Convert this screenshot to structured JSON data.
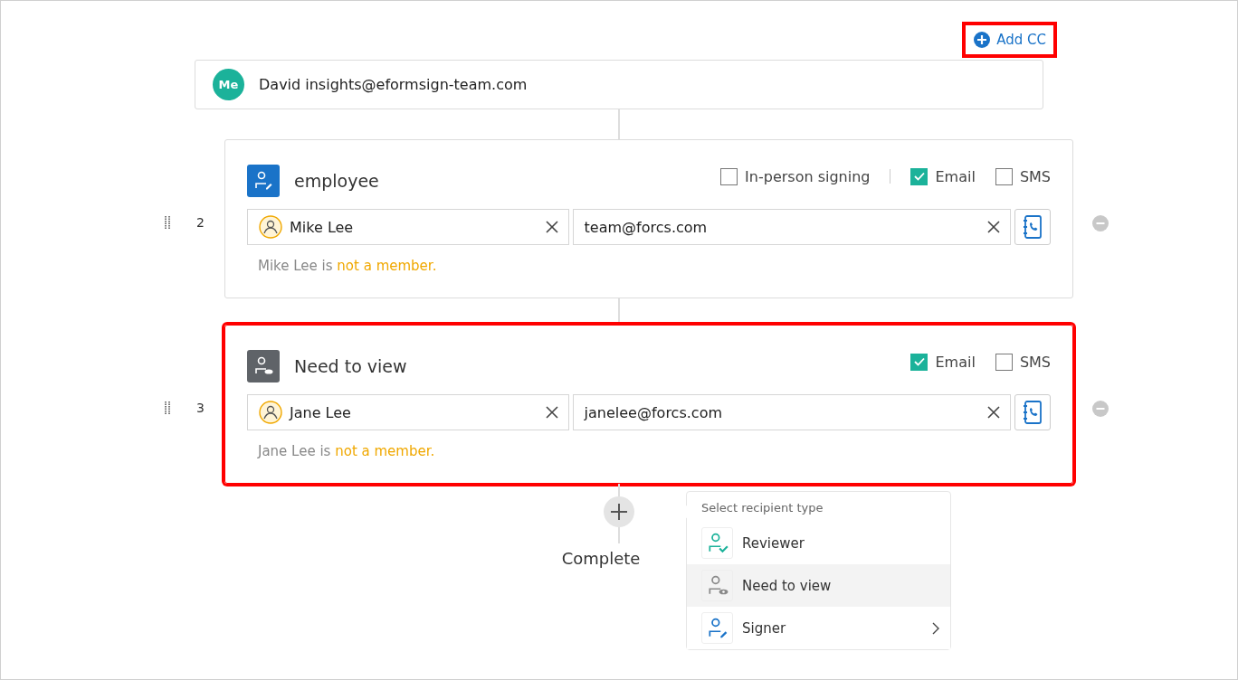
{
  "add_cc": {
    "label": "Add CC",
    "highlighted": true
  },
  "me": {
    "avatar": "Me",
    "text": "David insights@eformsign-team.com"
  },
  "steps": [
    {
      "number": "2",
      "role": {
        "kind": "signer",
        "title": "employee"
      },
      "highlighted": false,
      "options": [
        {
          "kind": "checkbox",
          "label": "In-person signing",
          "checked": false
        },
        {
          "kind": "separator"
        },
        {
          "kind": "checkbox",
          "label": "Email",
          "checked": true
        },
        {
          "kind": "checkbox",
          "label": "SMS",
          "checked": false
        }
      ],
      "name": "Mike Lee",
      "email": "team@forcs.com",
      "note": {
        "text": "Mike Lee is",
        "status": "not a member."
      }
    },
    {
      "number": "3",
      "role": {
        "kind": "viewer",
        "title": "Need to view"
      },
      "highlighted": true,
      "options": [
        {
          "kind": "checkbox",
          "label": "Email",
          "checked": true
        },
        {
          "kind": "checkbox",
          "label": "SMS",
          "checked": false
        }
      ],
      "name": "Jane Lee",
      "email": "janelee@forcs.com",
      "note": {
        "text": "Jane Lee is",
        "status": "not a member."
      }
    }
  ],
  "end_label": "Complete",
  "menu": {
    "title": "Select recipient type",
    "items": [
      {
        "kind": "reviewer",
        "label": "Reviewer",
        "selected": false,
        "submenu": false
      },
      {
        "kind": "viewer",
        "label": "Need to view",
        "selected": true,
        "submenu": false
      },
      {
        "kind": "signer",
        "label": "Signer",
        "selected": false,
        "submenu": true
      }
    ]
  }
}
